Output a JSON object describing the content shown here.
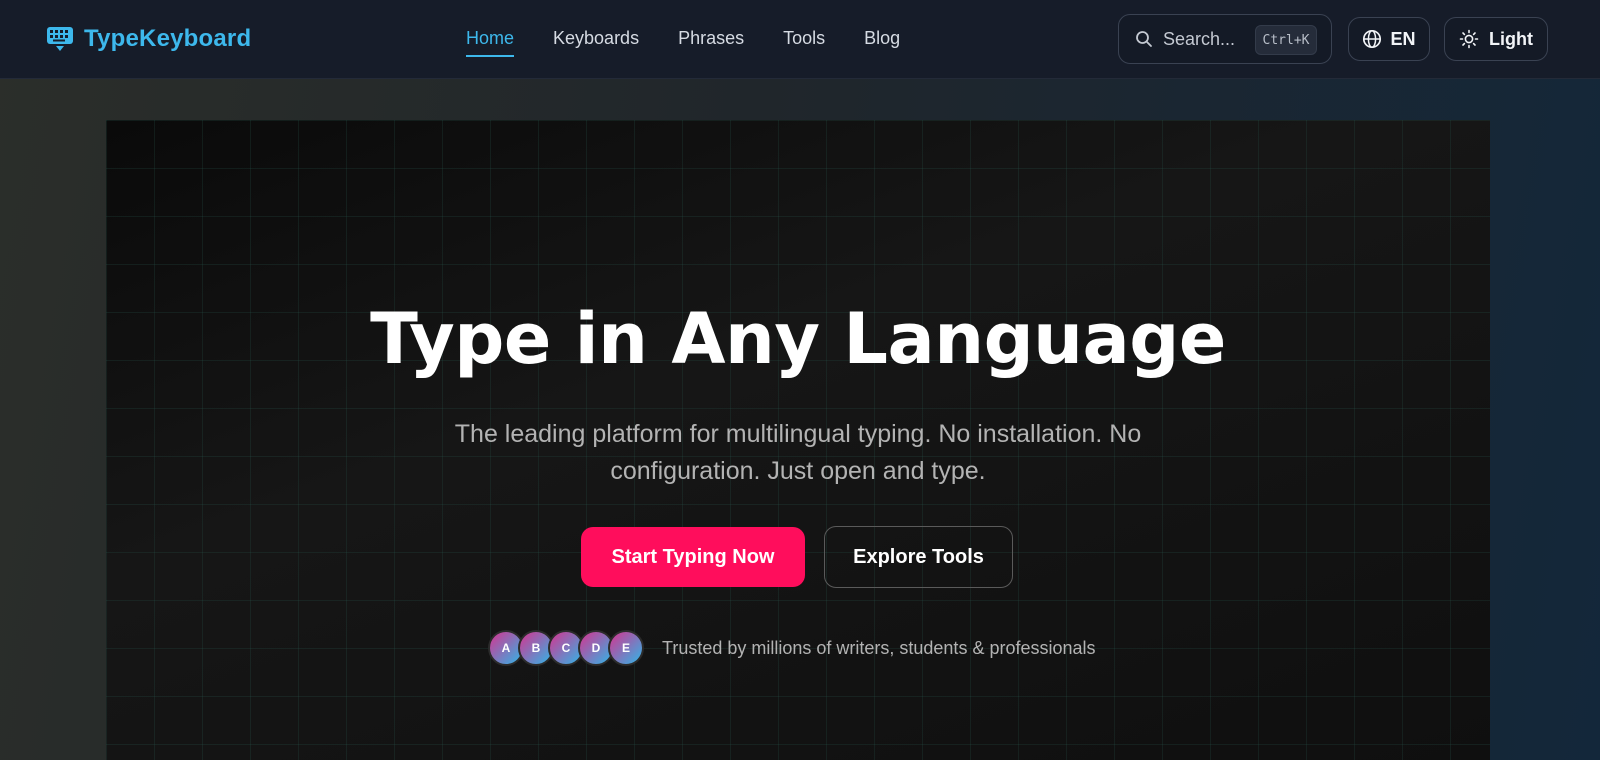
{
  "brand": {
    "name": "TypeKeyboard",
    "icon": "keyboard-icon",
    "color": "#3db8ec"
  },
  "nav": {
    "items": [
      {
        "label": "Home",
        "active": true
      },
      {
        "label": "Keyboards",
        "active": false
      },
      {
        "label": "Phrases",
        "active": false
      },
      {
        "label": "Tools",
        "active": false
      },
      {
        "label": "Blog",
        "active": false
      }
    ]
  },
  "search": {
    "placeholder": "Search...",
    "shortcut": "Ctrl+K",
    "icon": "search-icon"
  },
  "language": {
    "label": "EN",
    "icon": "globe-icon"
  },
  "theme": {
    "label": "Light",
    "icon": "sun-icon"
  },
  "hero": {
    "title": "Type in Any Language",
    "subtitle": "The leading platform for multilingual typing. No installation. No configuration. Just open and type.",
    "primary_cta": "Start Typing Now",
    "secondary_cta": "Explore Tools",
    "avatars": [
      "A",
      "B",
      "C",
      "D",
      "E"
    ],
    "trust_text": "Trusted by millions of writers, students & professionals"
  },
  "colors": {
    "accent": "#3db8ec",
    "primary_button": "#ff0d5c"
  }
}
